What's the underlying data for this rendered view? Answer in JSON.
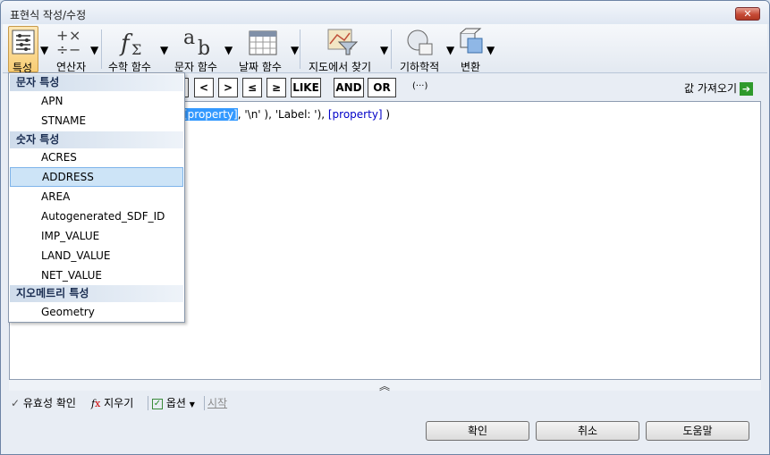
{
  "window": {
    "title": "표현식 작성/수정",
    "close_label": "✕"
  },
  "ribbon": {
    "properties": "특성",
    "operators": "연산자",
    "math": "수학 함수",
    "string": "문자 함수",
    "date": "날짜 함수",
    "find_map": "지도에서 찾기",
    "geometry": "기하학적",
    "convert": "변환"
  },
  "operators": [
    "<",
    ">",
    "≤",
    "≥",
    "LIKE",
    "AND",
    "OR"
  ],
  "ellipsis": "(···)",
  "get_values": "값 가져오기",
  "expression": {
    "prop1": "[property]",
    "mid": ", '\\n' ), 'Label: '), ",
    "prop2": "[property]",
    "tail": " )"
  },
  "dropdown": {
    "string_header": "문자 특성",
    "string_items": [
      "APN",
      "STNAME"
    ],
    "number_header": "숫자 특성",
    "number_items": [
      "ACRES",
      "ADDRESS",
      "AREA",
      "Autogenerated_SDF_ID",
      "IMP_VALUE",
      "LAND_VALUE",
      "NET_VALUE"
    ],
    "geometry_header": "지오메트리 특성",
    "geometry_items": [
      "Geometry"
    ],
    "highlighted": "ADDRESS"
  },
  "bottom": {
    "validate": "유효성 확인",
    "clear": "지우기",
    "options": "옵션",
    "start": "시작"
  },
  "buttons": {
    "ok": "확인",
    "cancel": "취소",
    "help": "도움말"
  },
  "colors": {
    "accent": "#3399ff",
    "highlight": "#cde4f7",
    "go": "#2f9a2c"
  }
}
